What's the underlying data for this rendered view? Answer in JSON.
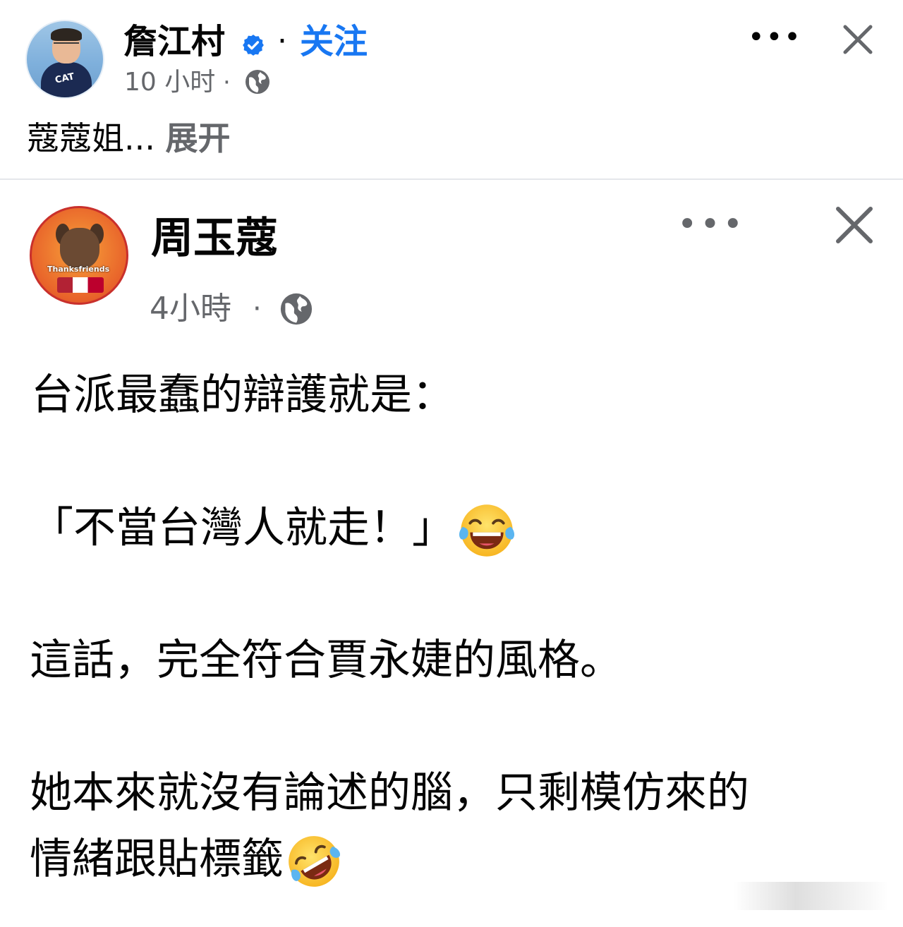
{
  "outer_post": {
    "author_name": "詹江村",
    "separator": "·",
    "follow_label": "关注",
    "time": "10 小时",
    "text_preview": "蔻蔻姐...",
    "expand_label": "展开",
    "avatar_shirt_text": "CAT",
    "verified_color": "#1877f2",
    "icons": [
      "verified-badge-icon",
      "globe-icon",
      "more-icon",
      "close-icon"
    ]
  },
  "inner_post": {
    "author_name": "周玉蔻",
    "time": "4小時",
    "separator": "·",
    "avatar_badge_text": "Thanksfriends",
    "lines": [
      "台派最蠢的辯護就是：",
      "「不當台灣人就走！」",
      "這話，完全符合賈永婕的風格。",
      "她本來就沒有論述的腦，只剩模仿來的",
      "情緒跟貼標籤"
    ],
    "emojis": [
      "face-with-tears-of-joy-icon",
      "rolling-on-floor-laughing-icon"
    ],
    "icons": [
      "globe-icon",
      "more-icon",
      "close-icon"
    ]
  },
  "colors": {
    "link_blue": "#1877f2",
    "secondary_text": "#65676b",
    "divider": "#e4e6eb"
  }
}
